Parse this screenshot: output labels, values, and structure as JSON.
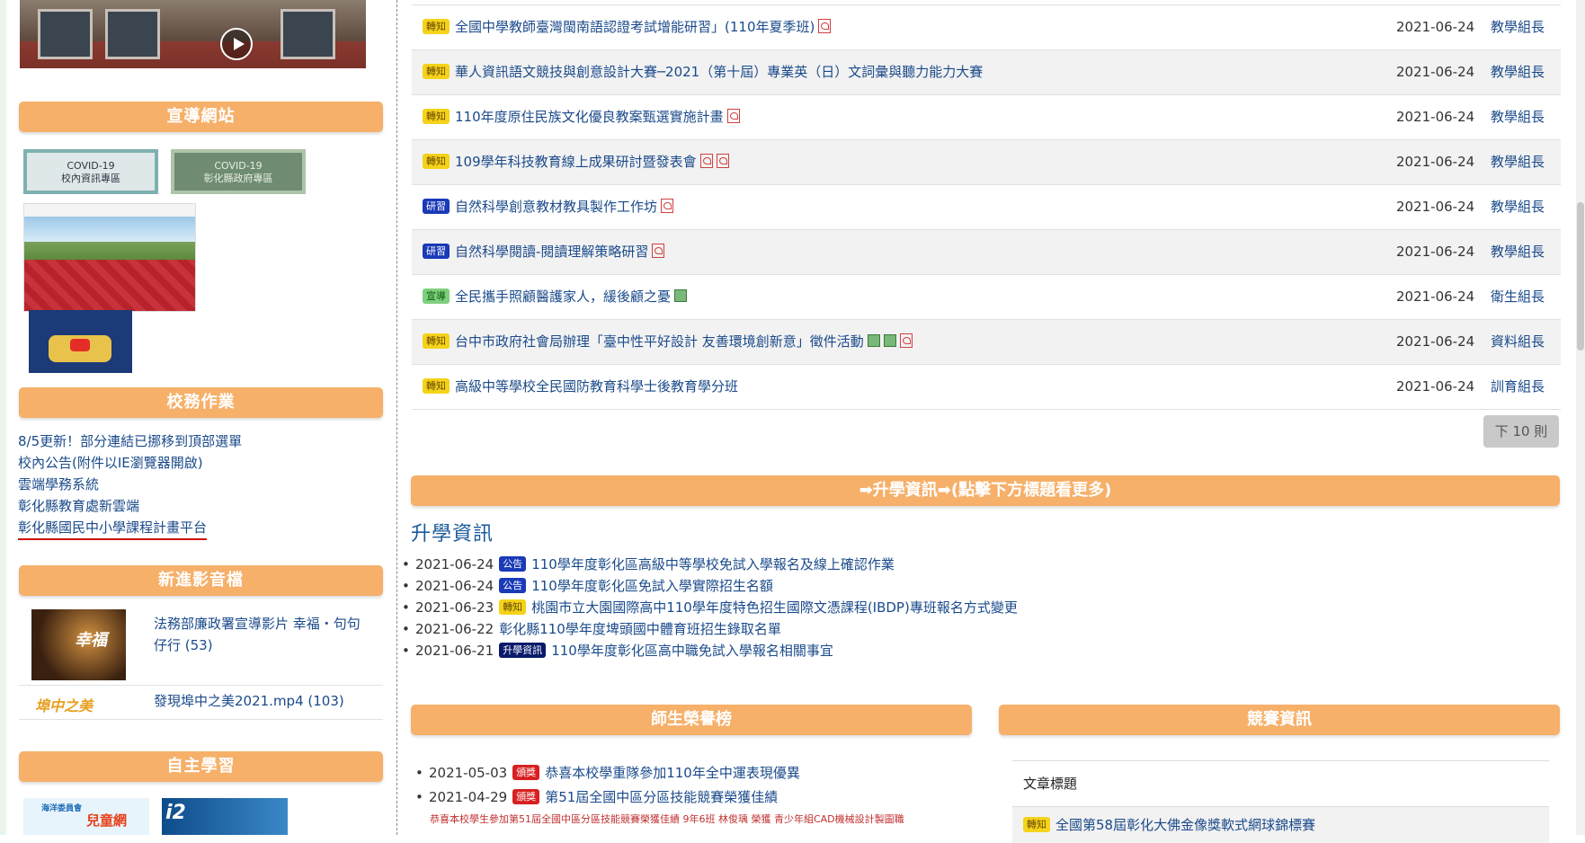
{
  "sidebar": {
    "sections": {
      "promo_sites": "宣導網站",
      "school_affairs": "校務作業",
      "new_media": "新進影音檔",
      "self_learning": "自主學習"
    },
    "covid_banners": [
      {
        "line1": "COVID-19",
        "line2": "校內資訊專區"
      },
      {
        "line1": "COVID-19",
        "line2": "彰化縣政府專區"
      }
    ],
    "affairs_links": [
      "8/5更新！部分連結已挪移到頂部選單",
      "校內公告(附件以IE瀏覽器開啟)",
      "雲端學務系統",
      "彰化縣教育處新雲端",
      "彰化縣國民中小學課程計畫平台"
    ],
    "media": [
      {
        "title": "法務部廉政署宣導影片 幸福・句句仔行 (53)",
        "thumb_text": "幸福"
      },
      {
        "title": "發現埠中之美2021.mp4 (103)",
        "thumb_text": "埠中之美"
      }
    ],
    "learning_banners": {
      "first": "兒童網",
      "first_prefix": "海洋委員會",
      "second": "i2"
    }
  },
  "news": [
    {
      "badge": "轉知",
      "badge_color": "yellow",
      "title": "全國中學教師臺灣閩南語認證考試增能研習」(110年夏季班)",
      "icons": [
        "pdf"
      ],
      "date": "2021-06-24",
      "author": "教學組長"
    },
    {
      "badge": "轉知",
      "badge_color": "yellow",
      "title": "華人資訊語文競技與創意設計大賽─2021（第十屆）專業英（日）文詞彙與聽力能力大賽",
      "icons": [],
      "date": "2021-06-24",
      "author": "教學組長"
    },
    {
      "badge": "轉知",
      "badge_color": "yellow",
      "title": "110年度原住民族文化優良教案甄選實施計畫",
      "icons": [
        "pdf"
      ],
      "date": "2021-06-24",
      "author": "教學組長"
    },
    {
      "badge": "轉知",
      "badge_color": "yellow",
      "title": "109學年科技教育線上成果研討暨發表會",
      "icons": [
        "pdf",
        "pdf"
      ],
      "date": "2021-06-24",
      "author": "教學組長"
    },
    {
      "badge": "研習",
      "badge_color": "blue",
      "title": "自然科學創意教材教具製作工作坊",
      "icons": [
        "pdf"
      ],
      "date": "2021-06-24",
      "author": "教學組長"
    },
    {
      "badge": "研習",
      "badge_color": "blue",
      "title": "自然科學閱讀-閱讀理解策略研習",
      "icons": [
        "pdf"
      ],
      "date": "2021-06-24",
      "author": "教學組長"
    },
    {
      "badge": "宣導",
      "badge_color": "green",
      "title": "全民攜手照顧醫護家人，緩後顧之憂",
      "icons": [
        "img"
      ],
      "date": "2021-06-24",
      "author": "衛生組長"
    },
    {
      "badge": "轉知",
      "badge_color": "yellow",
      "title": "台中市政府社會局辦理「臺中性平好設計 友善環境創新意」徵件活動",
      "icons": [
        "img",
        "img",
        "pdf"
      ],
      "date": "2021-06-24",
      "author": "資料組長"
    },
    {
      "badge": "轉知",
      "badge_color": "yellow",
      "title": "高級中等學校全民國防教育科學士後教育學分班",
      "icons": [],
      "date": "2021-06-24",
      "author": "訓育組長"
    }
  ],
  "next_button": "下 10 則",
  "admission": {
    "bar": "➡升學資訊➡(點擊下方標題看更多)",
    "title": "升學資訊",
    "items": [
      {
        "date": "2021-06-24",
        "badge": "公告",
        "badge_color": "blue",
        "title": "110學年度彰化區高級中等學校免試入學報名及線上確認作業"
      },
      {
        "date": "2021-06-24",
        "badge": "公告",
        "badge_color": "blue",
        "title": "110學年度彰化區免試入學實際招生名額"
      },
      {
        "date": "2021-06-23",
        "badge": "轉知",
        "badge_color": "yellow",
        "title": "桃園市立大園國際高中110學年度特色招生國際文憑課程(IBDP)專班報名方式變更"
      },
      {
        "date": "2021-06-22",
        "badge": "",
        "badge_color": "",
        "title": "彰化縣110學年度埤頭國中體育班招生錄取名單"
      },
      {
        "date": "2021-06-21",
        "badge": "升學資訊",
        "badge_color": "navy",
        "title": "110學年度彰化區高中職免試入學報名相關事宜"
      }
    ]
  },
  "honor": {
    "bar": "師生榮譽榜",
    "items": [
      {
        "date": "2021-05-03",
        "badge": "頒獎",
        "title": "恭喜本校學重隊參加110年全中運表現優異"
      },
      {
        "date": "2021-04-29",
        "badge": "頒獎",
        "title": "第51屆全國中區分區技能競賽榮獲佳績"
      }
    ],
    "sub_text": "恭喜本校學生參加第51屆全國中區分區技能競賽榮獲佳績 9年6班 林俊瑀 榮獲 青少年組CAD機械設計製圖職"
  },
  "contest": {
    "bar": "競賽資訊",
    "header": "文章標題",
    "rows": [
      {
        "badge": "轉知",
        "title": "全國第58屆彰化大佛金像獎軟式網球錦標賽"
      }
    ]
  }
}
